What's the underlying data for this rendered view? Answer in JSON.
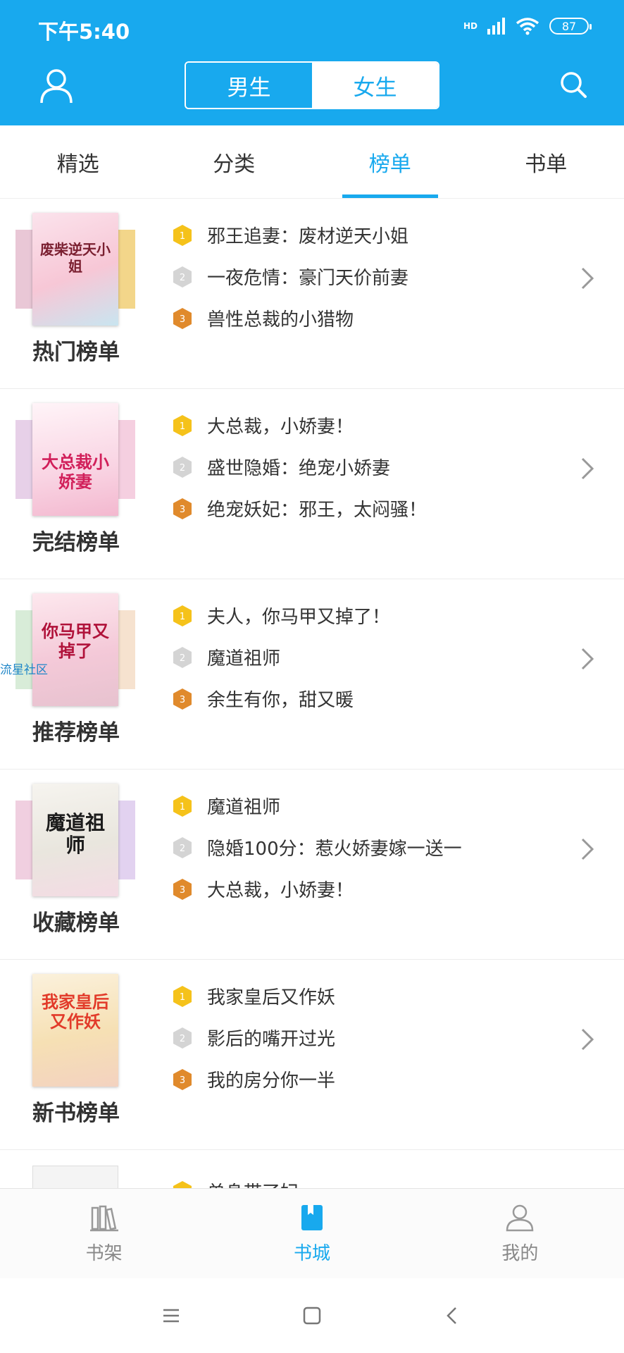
{
  "status": {
    "time": "下午5:40",
    "battery": "87",
    "network": "HD"
  },
  "header": {
    "gender_male": "男生",
    "gender_female": "女生",
    "selected": "女生"
  },
  "tabs": [
    {
      "label": "精选",
      "active": false
    },
    {
      "label": "分类",
      "active": false
    },
    {
      "label": "榜单",
      "active": true
    },
    {
      "label": "书单",
      "active": false
    }
  ],
  "rankings": [
    {
      "title": "热门榜单",
      "cover_text": "废柴逆天小姐",
      "entries": [
        "邪王追妻：废材逆天小姐",
        "一夜危情：豪门天价前妻",
        "兽性总裁的小猎物"
      ]
    },
    {
      "title": "完结榜单",
      "cover_text": "大总裁小娇妻",
      "entries": [
        "大总裁，小娇妻！",
        "盛世隐婚：绝宠小娇妻",
        "绝宠妖妃：邪王，太闷骚！"
      ]
    },
    {
      "title": "推荐榜单",
      "cover_text": "你马甲又掉了",
      "entries": [
        "夫人，你马甲又掉了！",
        "魔道祖师",
        "余生有你，甜又暖"
      ]
    },
    {
      "title": "收藏榜单",
      "cover_text": "魔道祖师",
      "entries": [
        "魔道祖师",
        "隐婚100分：惹火娇妻嫁一送一",
        "大总裁，小娇妻！"
      ]
    },
    {
      "title": "新书榜单",
      "cover_text": "我家皇后又作妖",
      "entries": [
        "我家皇后又作妖",
        "影后的嘴开过光",
        "我的房分你一半"
      ]
    }
  ],
  "partial_entry": "单身带了妃",
  "watermark": "流星社区",
  "bottom_nav": [
    {
      "label": "书架",
      "icon": "bookshelf-icon",
      "active": false
    },
    {
      "label": "书城",
      "icon": "bookstore-icon",
      "active": true
    },
    {
      "label": "我的",
      "icon": "profile-icon",
      "active": false
    }
  ],
  "colors": {
    "accent": "#18a9ee",
    "gold": "#f5c21a",
    "silver": "#cfcfcf",
    "bronze": "#e08a2c"
  }
}
